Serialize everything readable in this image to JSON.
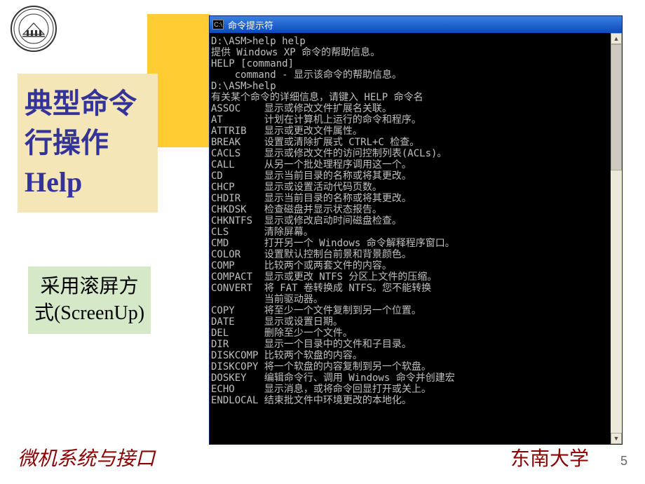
{
  "slide": {
    "title": "典型命令行操作Help",
    "subtitle": "采用滚屏方式(ScreenUp)",
    "footer_left": "微机系统与接口",
    "footer_right": "东南大学",
    "page_number": "5"
  },
  "cmd_window": {
    "titlebar": "命令提示符",
    "icon_label": "C:\\",
    "lines": [
      "D:\\ASM>help help",
      "提供 Windows XP 命令的帮助信息。",
      "",
      "HELP [command]",
      "",
      "    command - 显示该命令的帮助信息。",
      "",
      "D:\\ASM>help",
      "有关某个命令的详细信息，请键入 HELP 命令名",
      "ASSOC    显示或修改文件扩展名关联。",
      "AT       计划在计算机上运行的命令和程序。",
      "ATTRIB   显示或更改文件属性。",
      "BREAK    设置或清除扩展式 CTRL+C 检查。",
      "CACLS    显示或修改文件的访问控制列表(ACLs)。",
      "CALL     从另一个批处理程序调用这一个。",
      "CD       显示当前目录的名称或将其更改。",
      "CHCP     显示或设置活动代码页数。",
      "CHDIR    显示当前目录的名称或将其更改。",
      "CHKDSK   检查磁盘并显示状态报告。",
      "CHKNTFS  显示或修改启动时间磁盘检查。",
      "CLS      清除屏幕。",
      "CMD      打开另一个 Windows 命令解释程序窗口。",
      "COLOR    设置默认控制台前景和背景颜色。",
      "COMP     比较两个或两套文件的内容。",
      "COMPACT  显示或更改 NTFS 分区上文件的压缩。",
      "CONVERT  将 FAT 卷转换成 NTFS。您不能转换",
      "         当前驱动器。",
      "COPY     将至少一个文件复制到另一个位置。",
      "DATE     显示或设置日期。",
      "DEL      删除至少一个文件。",
      "DIR      显示一个目录中的文件和子目录。",
      "DISKCOMP 比较两个软盘的内容。",
      "DISKCOPY 将一个软盘的内容复制到另一个软盘。",
      "DOSKEY   编辑命令行、调用 Windows 命令并创建宏",
      "ECHO     显示消息，或将命令回显打开或关上。",
      "ENDLOCAL 结束批文件中环境更改的本地化。"
    ]
  },
  "scrollbar": {
    "up": "▲",
    "down": "▼"
  }
}
